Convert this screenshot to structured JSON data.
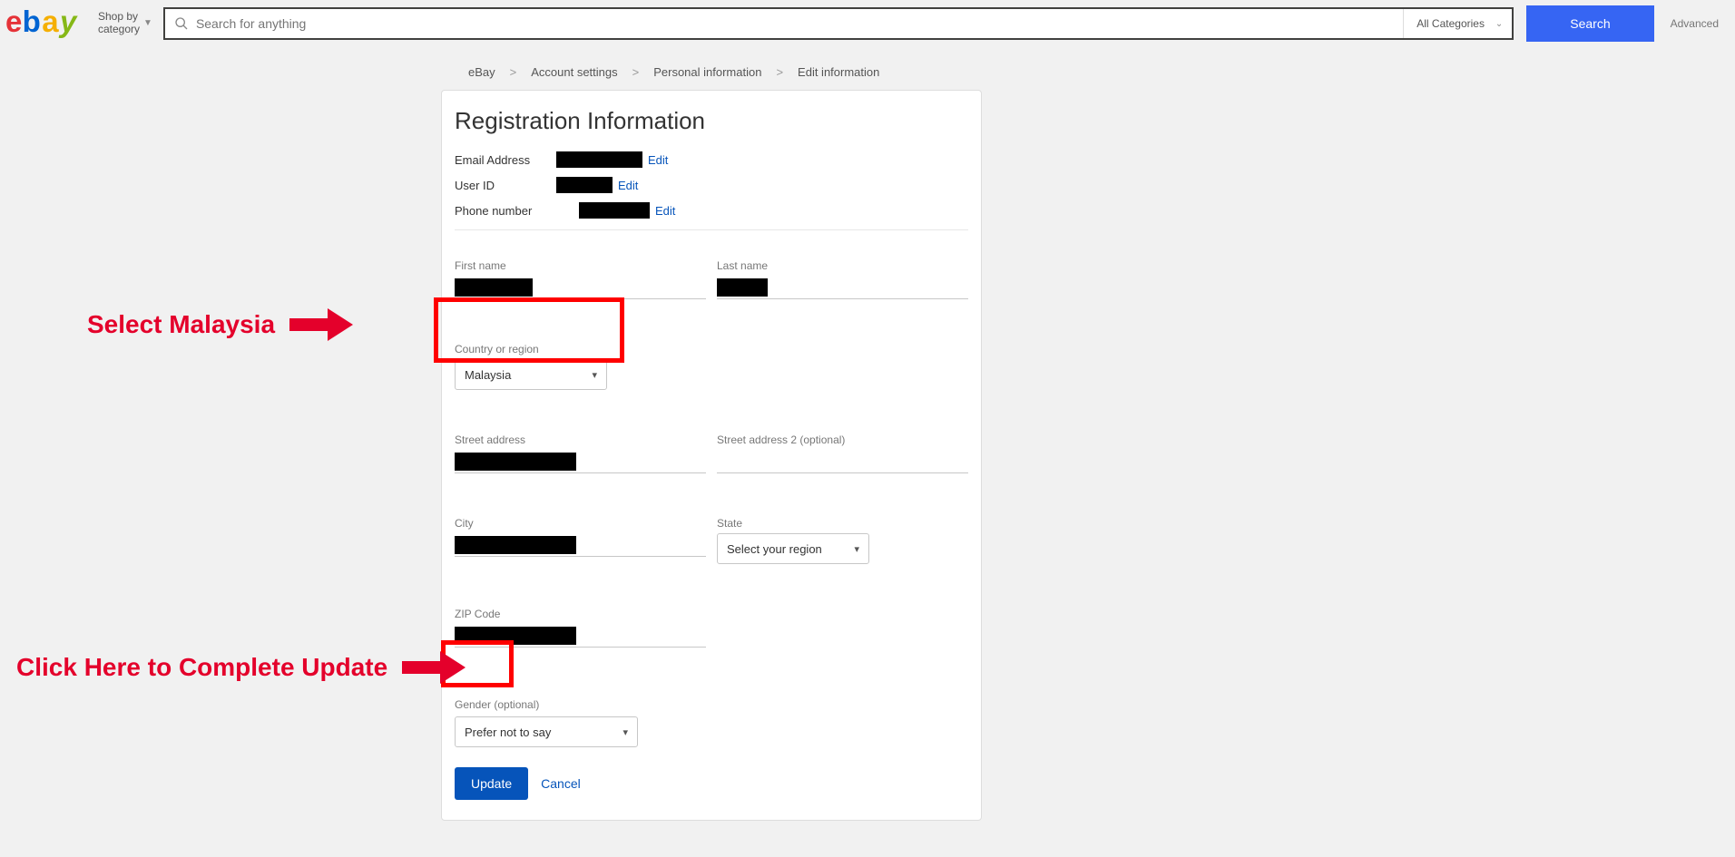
{
  "header": {
    "shop_by_line1": "Shop by",
    "shop_by_line2": "category",
    "search_placeholder": "Search for anything",
    "category_label": "All Categories",
    "search_button": "Search",
    "advanced": "Advanced"
  },
  "breadcrumb": {
    "items": [
      "eBay",
      "Account settings",
      "Personal information",
      "Edit information"
    ]
  },
  "page": {
    "title": "Registration Information",
    "email_label": "Email Address",
    "user_id_label": "User ID",
    "phone_label": "Phone number",
    "edit": "Edit",
    "first_name_label": "First name",
    "last_name_label": "Last name",
    "country_label": "Country or region",
    "country_value": "Malaysia",
    "street_label": "Street address",
    "street2_label": "Street address 2 (optional)",
    "city_label": "City",
    "state_label": "State",
    "state_value": "Select your region",
    "zip_label": "ZIP Code",
    "gender_label": "Gender (optional)",
    "gender_value": "Prefer not to say",
    "update_button": "Update",
    "cancel": "Cancel"
  },
  "annotations": {
    "select_malaysia": "Select Malaysia",
    "complete_update": "Click Here to Complete Update"
  }
}
